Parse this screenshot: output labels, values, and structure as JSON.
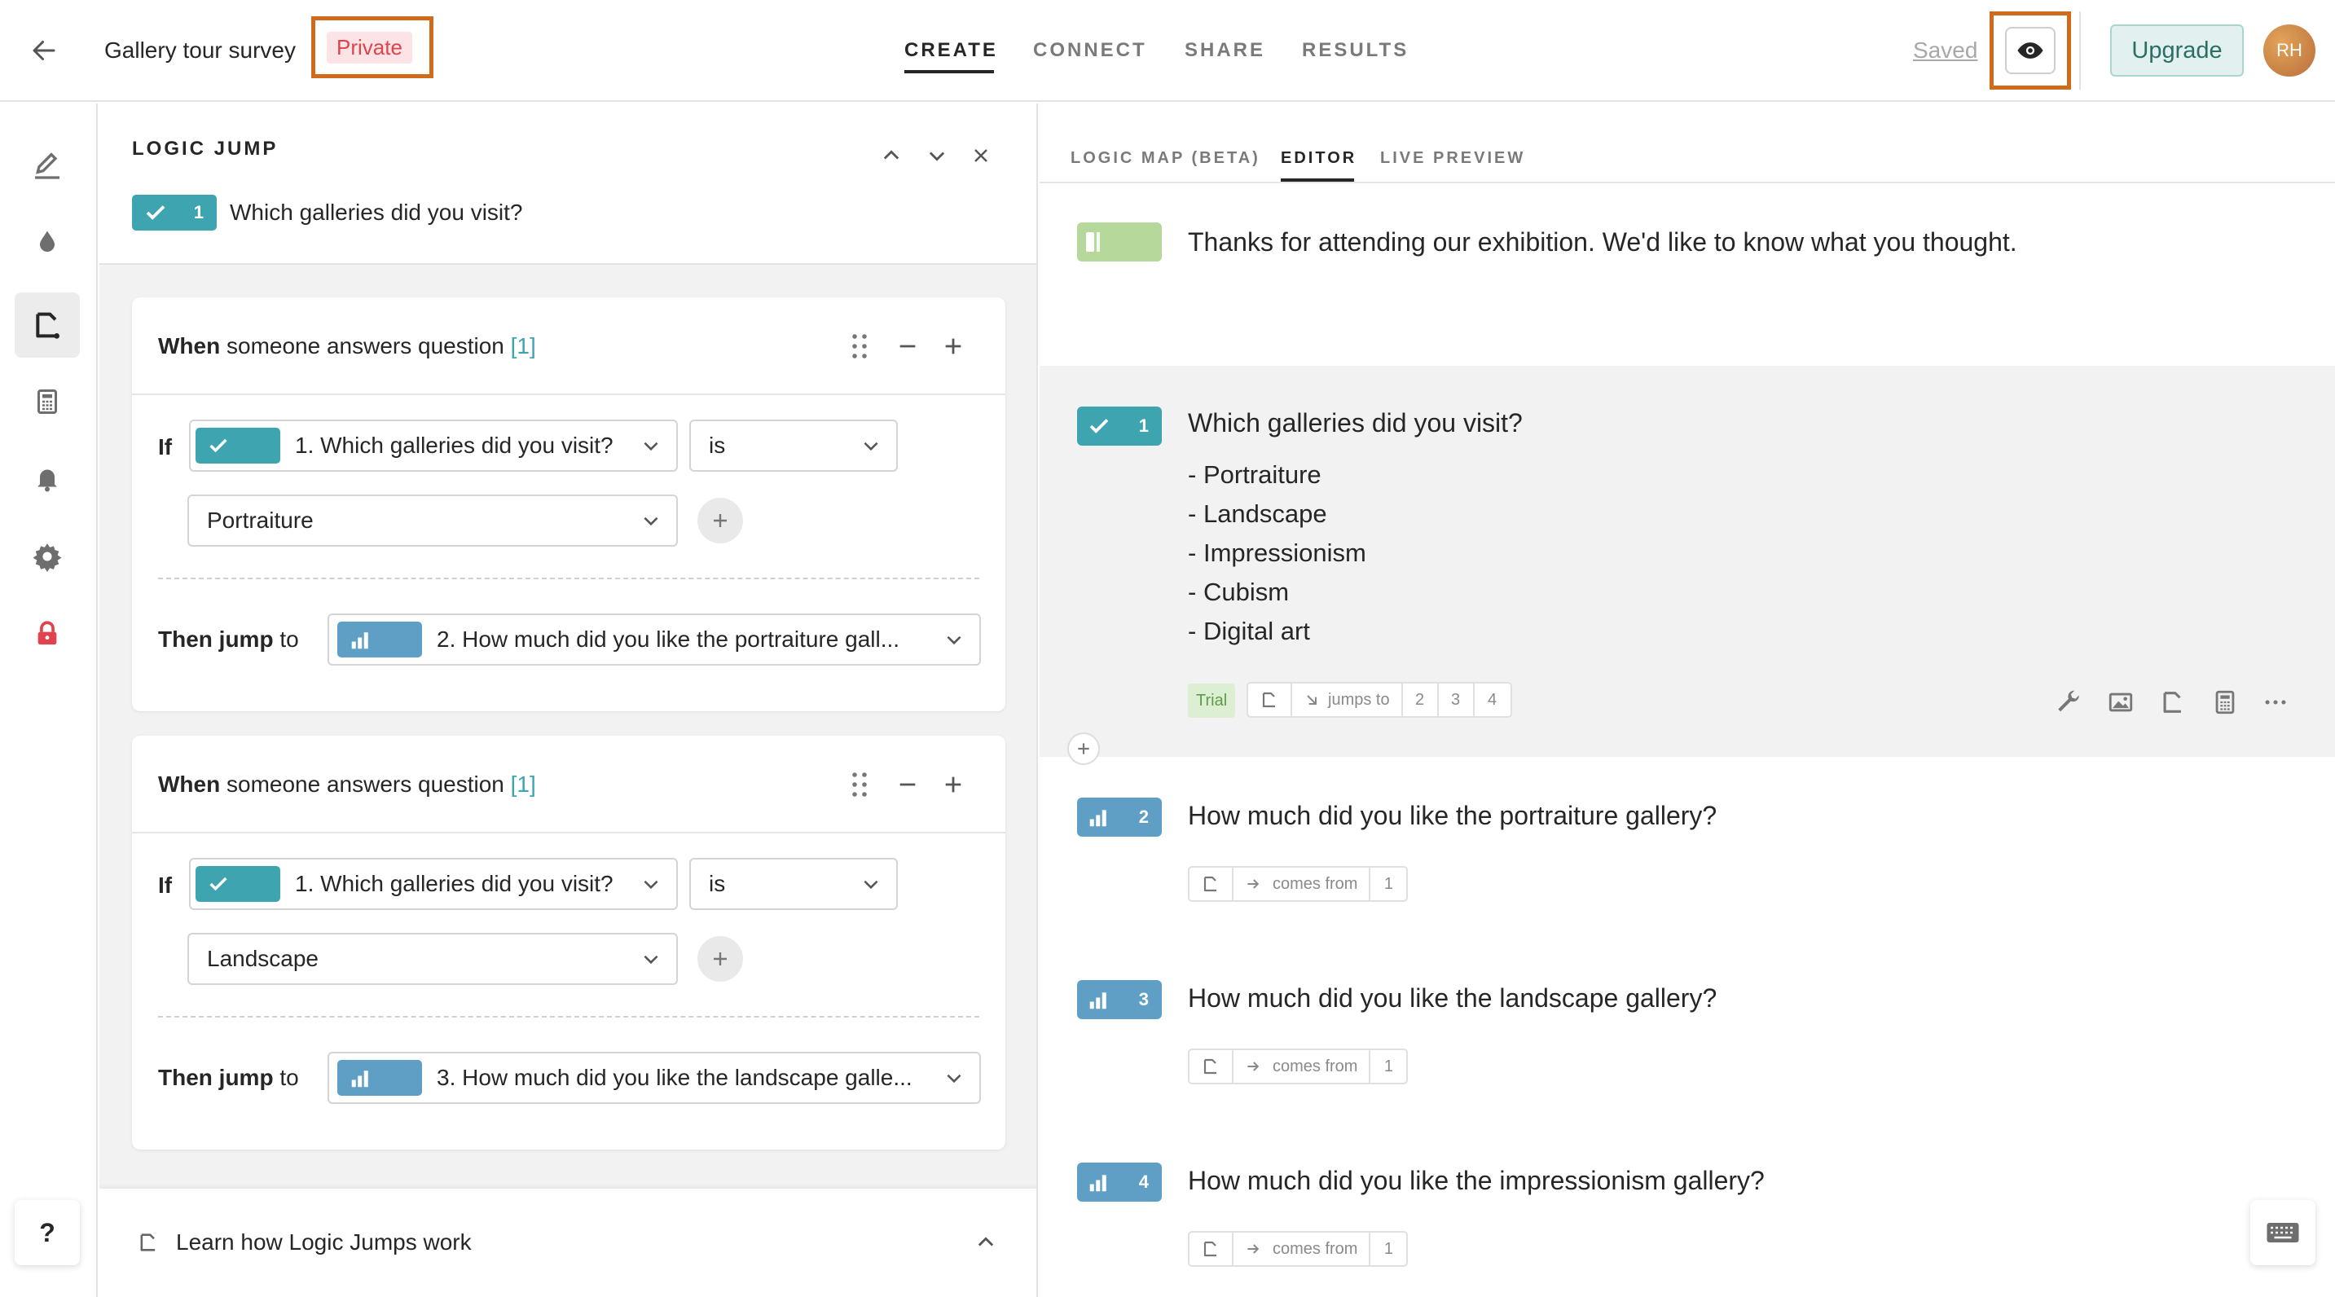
{
  "header": {
    "form_title": "Gallery tour survey",
    "privacy_badge": "Private",
    "nav_tabs": [
      "CREATE",
      "CONNECT",
      "SHARE",
      "RESULTS"
    ],
    "active_tab": "CREATE",
    "saved_label": "Saved",
    "upgrade_label": "Upgrade",
    "avatar_initials": "RH",
    "icons": [
      "back-arrow-icon",
      "eye-icon"
    ]
  },
  "rail": {
    "icons": [
      "pen-icon",
      "droplet-icon",
      "logic-branch-icon",
      "calculator-icon",
      "bell-icon",
      "gear-icon",
      "lock-icon"
    ],
    "help_label": "?"
  },
  "logic_panel": {
    "title": "LOGIC JUMP",
    "question_number": "1",
    "question_text": "Which galleries did you visit?",
    "rules": [
      {
        "when_bold": "When",
        "when_text": "someone answers question",
        "question_ref": "[1]",
        "if_label": "If",
        "if_question": "1. Which galleries did you visit?",
        "operator": "is",
        "value": "Portraiture",
        "then_bold": "Then jump",
        "then_to": "to",
        "target": "2. How much did you like the portraiture gall..."
      },
      {
        "when_bold": "When",
        "when_text": "someone answers question",
        "question_ref": "[1]",
        "if_label": "If",
        "if_question": "1. Which galleries did you visit?",
        "operator": "is",
        "value": "Landscape",
        "then_bold": "Then jump",
        "then_to": "to",
        "target": "3. How much did you like the landscape galle..."
      }
    ],
    "footer_link": "Learn how Logic Jumps work"
  },
  "editor": {
    "tabs": [
      "LOGIC MAP (BETA)",
      "EDITOR",
      "LIVE PREVIEW"
    ],
    "active_tab": "EDITOR",
    "welcome_text": "Thanks for attending our exhibition. We'd like to know what you thought.",
    "questions": [
      {
        "number": "1",
        "title": "Which galleries did you visit?",
        "choices": [
          "Portraiture",
          "Landscape",
          "Impressionism",
          "Cubism",
          "Digital art"
        ],
        "trial_label": "Trial",
        "jumps_label": "jumps to",
        "jumps_targets": [
          "2",
          "3",
          "4"
        ]
      },
      {
        "number": "2",
        "title": "How much did you like the portraiture gallery?",
        "comes_label": "comes from",
        "comes_source": "1"
      },
      {
        "number": "3",
        "title": "How much did you like the landscape gallery?",
        "comes_label": "comes from",
        "comes_source": "1"
      },
      {
        "number": "4",
        "title": "How much did you like the impressionism gallery?",
        "comes_label": "comes from",
        "comes_source": "1"
      }
    ],
    "choice_prefix": "-"
  },
  "colors": {
    "accent_teal": "#3ea4b0",
    "opinion_blue": "#5f9fc6",
    "welcome_green": "#b6d99b",
    "highlight_orange": "#d06b1c",
    "private_red": "#e0434b",
    "upgrade_bg": "#e2f1ef"
  }
}
